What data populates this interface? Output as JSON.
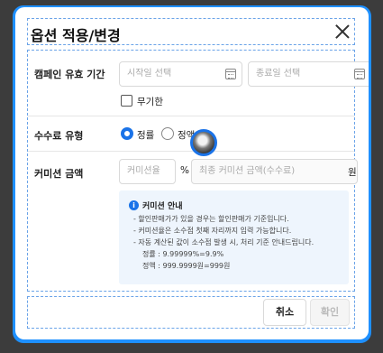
{
  "modal": {
    "title": "옵션 적용/변경"
  },
  "campaign_period": {
    "label": "캠페인 유효 기간",
    "start_placeholder": "시작일 선택",
    "end_placeholder": "종료일 선택",
    "unlimited_label": "무기한"
  },
  "fee_type": {
    "label": "수수료 유형",
    "options": [
      "정률",
      "정액"
    ],
    "selected": "정률"
  },
  "commission": {
    "label": "커미션 금액",
    "rate_placeholder": "커미션율",
    "percent_unit": "%",
    "final_placeholder": "최종 커미션 금액(수수료)",
    "currency_unit": "원"
  },
  "info": {
    "title": "커미션 안내",
    "lines": [
      "- 할인판매가가 있을 경우는 할인판매가 기준입니다.",
      "- 커미션율은 소수점 첫째 자리까지 입력 가능합니다.",
      "- 자동 계산된 값이 소수점 발생 시, 처리 기준 안내드립니다.",
      "정률 : 9.99999%=9.9%",
      "정액 : 999.9999원=999원"
    ]
  },
  "footer": {
    "cancel_label": "취소",
    "confirm_label": "확인"
  },
  "colors": {
    "accent": "#1a73e8",
    "frame": "#1e90ff",
    "info_bg": "#eef5fd"
  }
}
